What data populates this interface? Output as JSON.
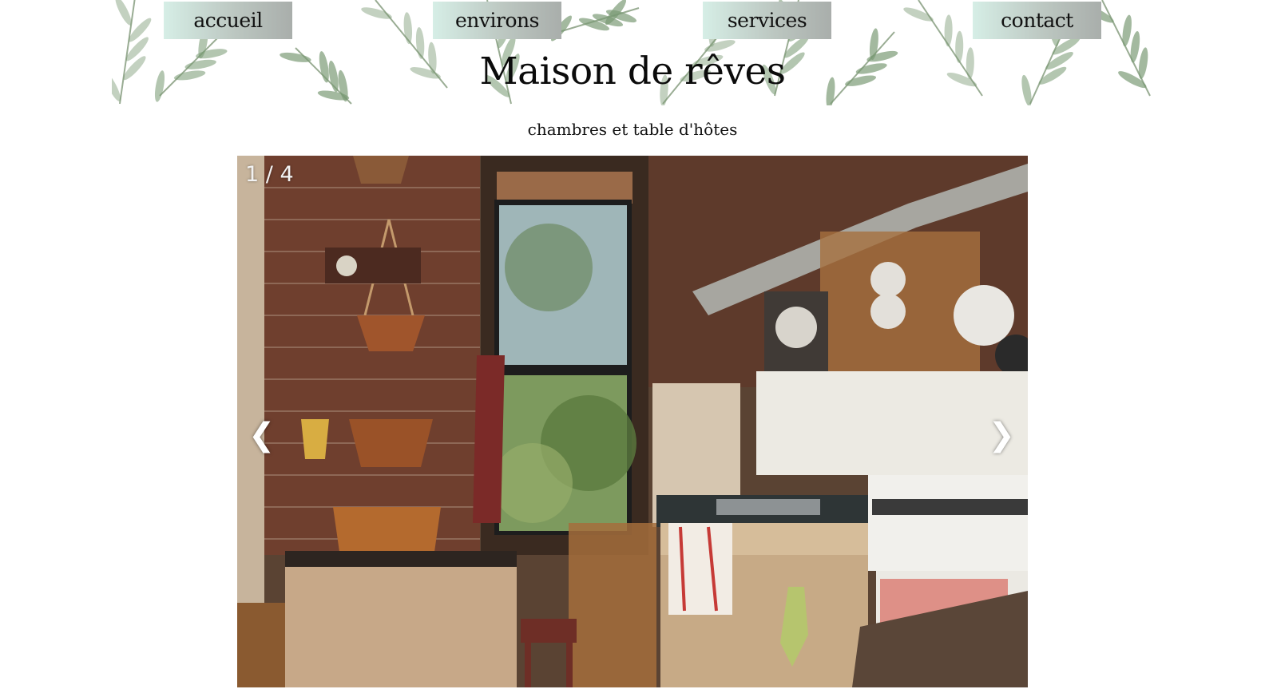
{
  "nav": {
    "items": [
      {
        "label": "accueil"
      },
      {
        "label": "environs"
      },
      {
        "label": "services"
      },
      {
        "label": "contact"
      }
    ]
  },
  "site": {
    "title": "Maison de rêves",
    "subtitle": "chambres et table d'hôtes"
  },
  "slideshow": {
    "counter": "1 / 4",
    "prev_icon": "❮",
    "next_icon": "❯",
    "current_slide": 1,
    "total_slides": 4
  },
  "colors": {
    "nav_button_start": "#d6eee6",
    "nav_button_end": "#a9aeab",
    "leaf_green": "#7a9a74"
  }
}
